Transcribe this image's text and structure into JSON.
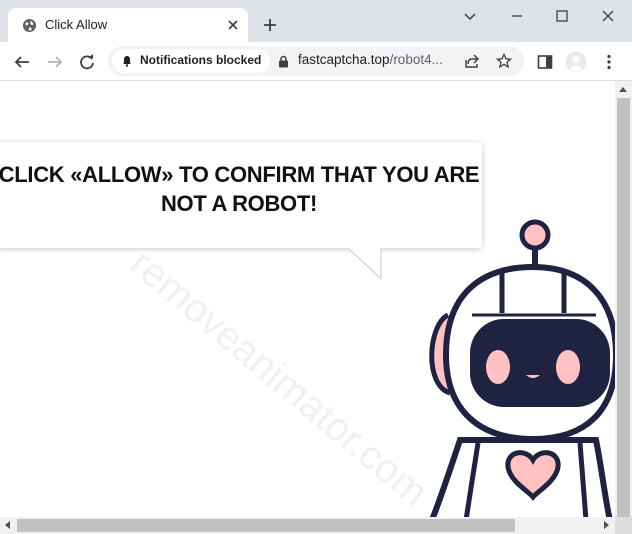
{
  "tab": {
    "title": "Click Allow",
    "favicon": "globe-icon"
  },
  "omnibox": {
    "notification_chip": "Notifications blocked",
    "url_host": "fastcaptcha.top",
    "url_path": "/robot4..."
  },
  "page": {
    "headline": "CLICK «ALLOW» TO CONFIRM THAT YOU ARE NOT A ROBOT!",
    "watermark": "removeanimator.com"
  },
  "colors": {
    "tab_strip": "#dee1e6",
    "robot_outline": "#1f2240",
    "robot_pink": "#ffc1c1",
    "robot_visor": "#1f2240"
  }
}
